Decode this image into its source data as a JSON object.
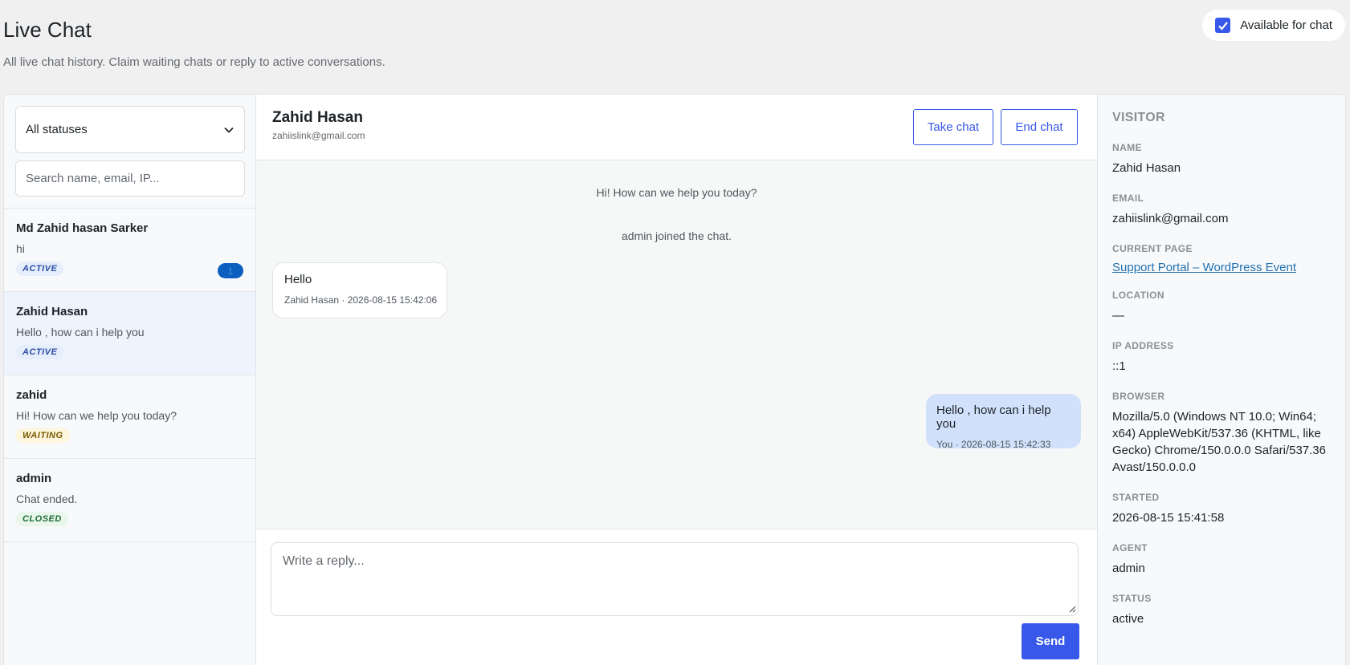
{
  "page": {
    "title": "Live Chat",
    "subtitle": "All live chat history. Claim waiting chats or reply to active conversations."
  },
  "availability": {
    "label": "Available for chat",
    "checked": true
  },
  "sidebar": {
    "status_filter": "All statuses",
    "search_placeholder": "Search name, email, IP...",
    "conversations": [
      {
        "name": "Md Zahid hasan Sarker",
        "snippet": "hi",
        "status": "ACTIVE",
        "unread": "1"
      },
      {
        "name": "Zahid Hasan",
        "snippet": "Hello , how can i help you",
        "status": "ACTIVE"
      },
      {
        "name": "zahid",
        "snippet": "Hi! How can we help you today?",
        "status": "WAITING"
      },
      {
        "name": "admin",
        "snippet": "Chat ended.",
        "status": "CLOSED"
      }
    ]
  },
  "chat": {
    "name": "Zahid Hasan",
    "email": "zahiislink@gmail.com",
    "take_label": "Take chat",
    "end_label": "End chat",
    "system_messages": [
      "Hi! How can we help you today?",
      "admin joined the chat."
    ],
    "incoming": {
      "text": "Hello",
      "meta": "Zahid Hasan · 2026-08-15 15:42:06"
    },
    "outgoing": {
      "text": "Hello , how can i help you",
      "meta": "You · 2026-08-15 15:42:33"
    },
    "reply_placeholder": "Write a reply...",
    "send_label": "Send"
  },
  "visitor": {
    "heading": "VISITOR",
    "name_label": "NAME",
    "name": "Zahid Hasan",
    "email_label": "EMAIL",
    "email": "zahiislink@gmail.com",
    "page_label": "CURRENT PAGE",
    "page": "Support Portal – WordPress Event",
    "location_label": "LOCATION",
    "location": "—",
    "ip_label": "IP ADDRESS",
    "ip": "::1",
    "browser_label": "BROWSER",
    "browser": "Mozilla/5.0 (Windows NT 10.0; Win64; x64) AppleWebKit/537.36 (KHTML, like Gecko) Chrome/150.0.0.0 Safari/537.36 Avast/150.0.0.0",
    "started_label": "STARTED",
    "started": "2026-08-15 15:41:58",
    "agent_label": "AGENT",
    "agent": "admin",
    "status_label": "STATUS",
    "status": "active"
  },
  "colors": {
    "accent": "#3858e9",
    "active_badge": "#2c4ea8",
    "waiting_badge": "#7a5a00",
    "closed_badge": "#1f6b34"
  }
}
